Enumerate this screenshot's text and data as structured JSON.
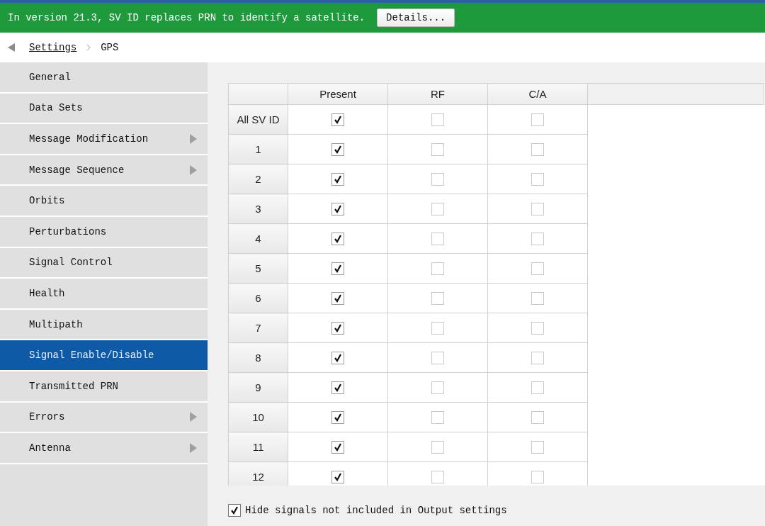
{
  "banner": {
    "message": "In version 21.3, SV ID replaces PRN to identify a satellite.",
    "button": "Details..."
  },
  "breadcrumb": {
    "items": [
      "Settings",
      "GPS"
    ]
  },
  "sidebar": {
    "items": [
      {
        "label": "General",
        "selected": false,
        "has_submenu": false
      },
      {
        "label": "Data Sets",
        "selected": false,
        "has_submenu": false
      },
      {
        "label": "Message Modification",
        "selected": false,
        "has_submenu": true
      },
      {
        "label": "Message Sequence",
        "selected": false,
        "has_submenu": true
      },
      {
        "label": "Orbits",
        "selected": false,
        "has_submenu": false
      },
      {
        "label": "Perturbations",
        "selected": false,
        "has_submenu": false
      },
      {
        "label": "Signal Control",
        "selected": false,
        "has_submenu": false
      },
      {
        "label": "Health",
        "selected": false,
        "has_submenu": false
      },
      {
        "label": "Multipath",
        "selected": false,
        "has_submenu": false
      },
      {
        "label": "Signal Enable/Disable",
        "selected": true,
        "has_submenu": false
      },
      {
        "label": "Transmitted PRN",
        "selected": false,
        "has_submenu": false
      },
      {
        "label": "Errors",
        "selected": false,
        "has_submenu": true
      },
      {
        "label": "Antenna",
        "selected": false,
        "has_submenu": true
      }
    ]
  },
  "table": {
    "columns": [
      "Present",
      "RF",
      "C/A"
    ],
    "rows": [
      {
        "header": "All SV ID",
        "checked": [
          true,
          false,
          false
        ]
      },
      {
        "header": "1",
        "checked": [
          true,
          false,
          false
        ]
      },
      {
        "header": "2",
        "checked": [
          true,
          false,
          false
        ]
      },
      {
        "header": "3",
        "checked": [
          true,
          false,
          false
        ]
      },
      {
        "header": "4",
        "checked": [
          true,
          false,
          false
        ]
      },
      {
        "header": "5",
        "checked": [
          true,
          false,
          false
        ]
      },
      {
        "header": "6",
        "checked": [
          true,
          false,
          false
        ]
      },
      {
        "header": "7",
        "checked": [
          true,
          false,
          false
        ]
      },
      {
        "header": "8",
        "checked": [
          true,
          false,
          false
        ]
      },
      {
        "header": "9",
        "checked": [
          true,
          false,
          false
        ]
      },
      {
        "header": "10",
        "checked": [
          true,
          false,
          false
        ]
      },
      {
        "header": "11",
        "checked": [
          true,
          false,
          false
        ]
      },
      {
        "header": "12",
        "checked": [
          true,
          false,
          false
        ]
      }
    ]
  },
  "hide_option": {
    "label": "Hide signals not included in Output settings",
    "checked": true
  }
}
